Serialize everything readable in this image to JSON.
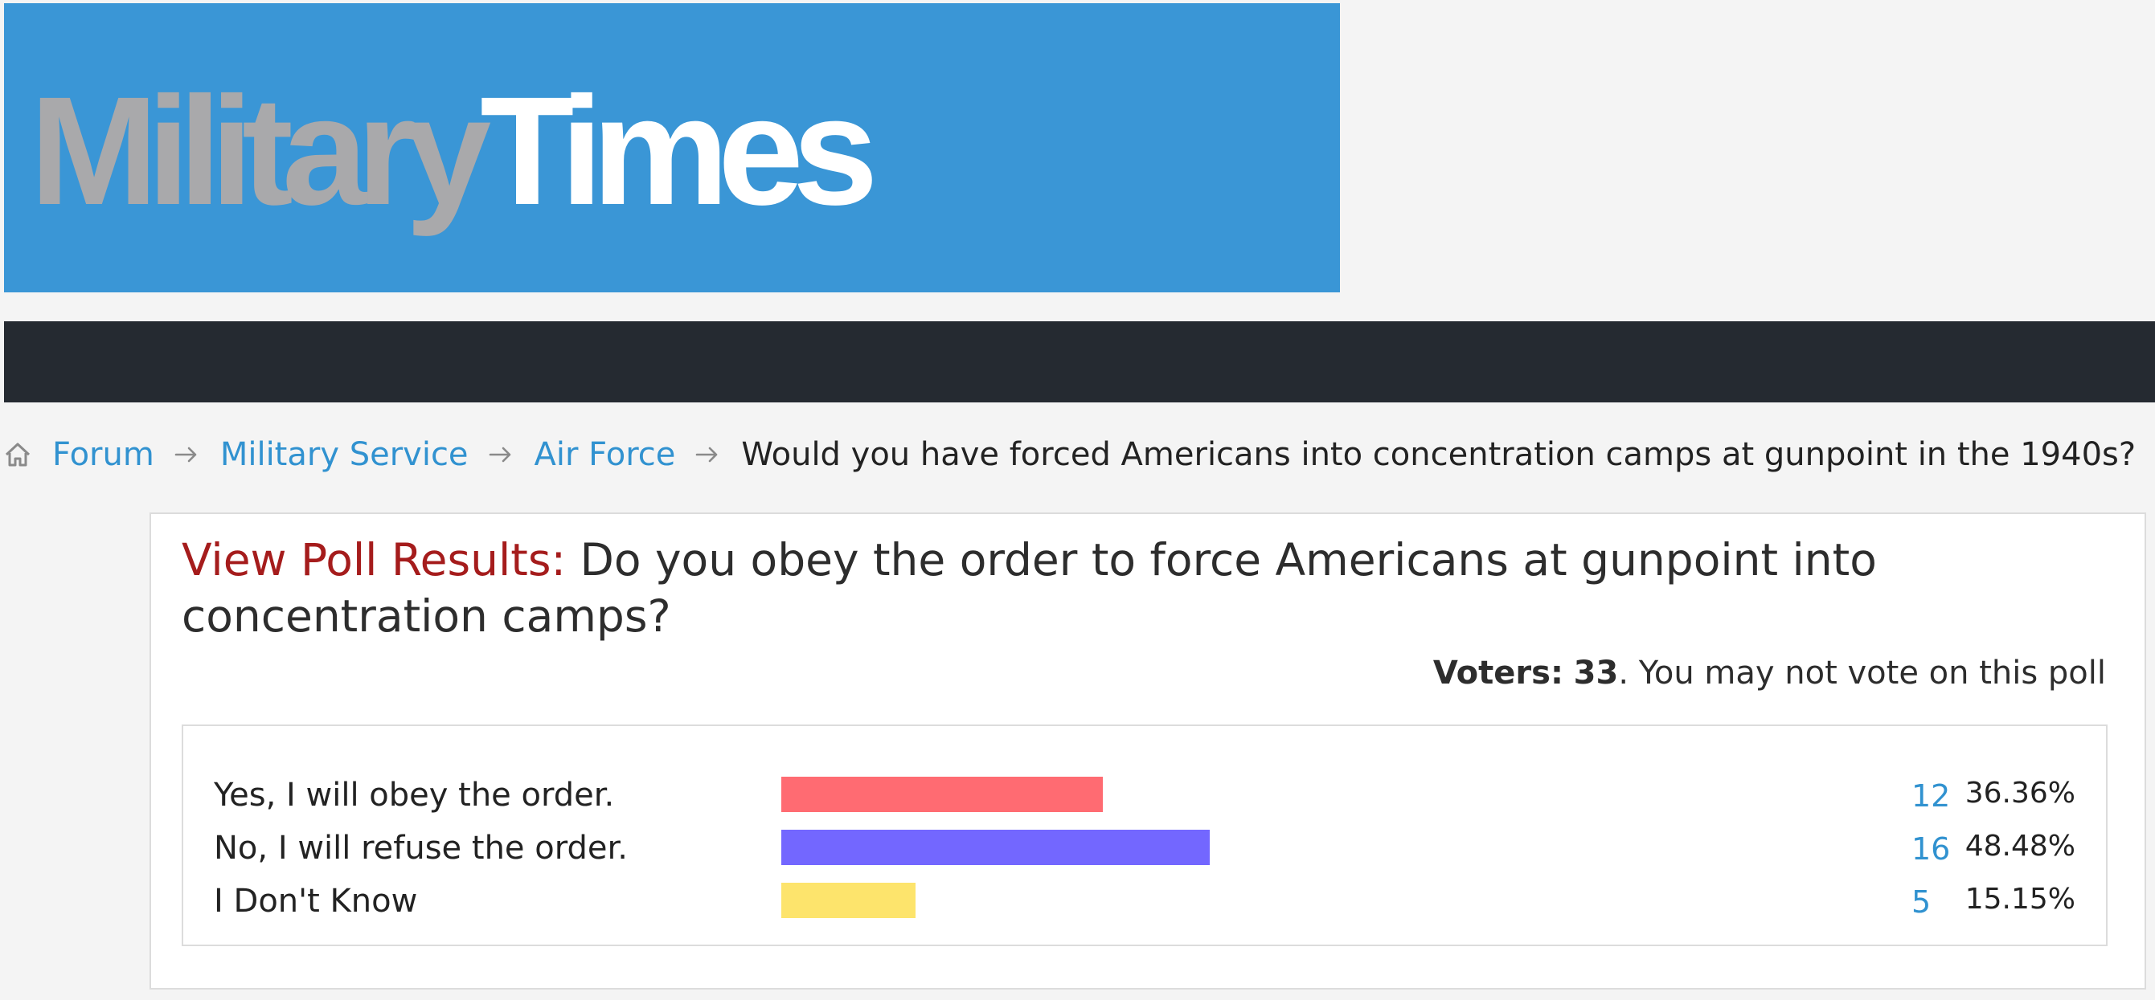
{
  "logo": {
    "part_gray": "Military",
    "part_white": "Times",
    "banner_color": "#3a96d6"
  },
  "breadcrumb": {
    "home_icon": "home-icon",
    "separator_icon": "arrow-right-icon",
    "links": [
      "Forum",
      "Military Service",
      "Air Force"
    ],
    "current": "Would you have forced Americans into concentration camps at gunpoint in the 1940s?"
  },
  "poll": {
    "title_label": "View Poll Results:",
    "question": "Do you obey the order to force Americans at gunpoint into concentration camps?",
    "voters_label": "Voters:",
    "voters_count": "33",
    "vote_note": ". You may not vote on this poll",
    "options": [
      {
        "label": "Yes, I will obey the order.",
        "count": "12",
        "percent": "36.36%",
        "share": 0.3636,
        "color": "#ff6b72"
      },
      {
        "label": "No, I will refuse the order.",
        "count": "16",
        "percent": "48.48%",
        "share": 0.4848,
        "color": "#7367ff"
      },
      {
        "label": "I Don't Know",
        "count": "5",
        "percent": "15.15%",
        "share": 0.1515,
        "color": "#fde46c"
      }
    ]
  }
}
